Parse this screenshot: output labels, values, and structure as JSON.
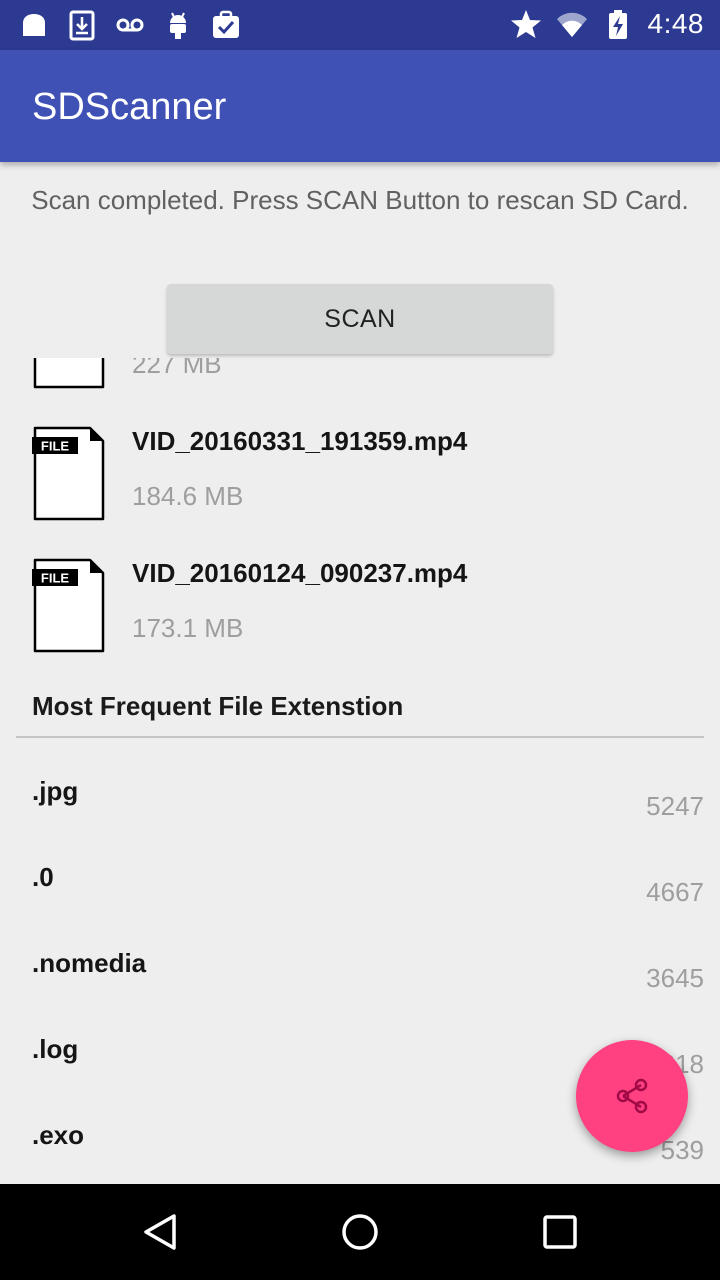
{
  "status_bar": {
    "time": "4:48",
    "left_icons": [
      "cloud-icon",
      "download-icon",
      "voicemail-icon",
      "android-icon",
      "clipboard-check-icon"
    ],
    "right_icons": [
      "star-icon",
      "wifi-icon",
      "battery-charging-icon"
    ]
  },
  "app_bar": {
    "title": "SDScanner"
  },
  "scan": {
    "status_text": "Scan completed. Press SCAN Button to rescan SD Card.",
    "button_label": "SCAN"
  },
  "largest_files": [
    {
      "name": "",
      "size": "227 MB",
      "icon": "file-icon"
    },
    {
      "name": "VID_20160331_191359.mp4",
      "size": "184.6 MB",
      "icon": "file-icon"
    },
    {
      "name": "VID_20160124_090237.mp4",
      "size": "173.1 MB",
      "icon": "file-icon"
    }
  ],
  "file_icon_label": "FILE",
  "extensions_section": {
    "title": "Most Frequent File Extenstion",
    "items": [
      {
        "ext": ".jpg",
        "count": "5247"
      },
      {
        "ext": ".0",
        "count": "4667"
      },
      {
        "ext": ".nomedia",
        "count": "3645"
      },
      {
        "ext": ".log",
        "count": "2318"
      },
      {
        "ext": ".exo",
        "count": "539"
      }
    ]
  },
  "fab": {
    "icon": "share-icon",
    "color": "#ff4081"
  },
  "nav_bar": {
    "icons": [
      "back-icon",
      "home-icon",
      "recents-icon"
    ]
  },
  "colors": {
    "primary": "#3f51b5",
    "primary_dark": "#2c3a91",
    "accent": "#ff4081"
  }
}
